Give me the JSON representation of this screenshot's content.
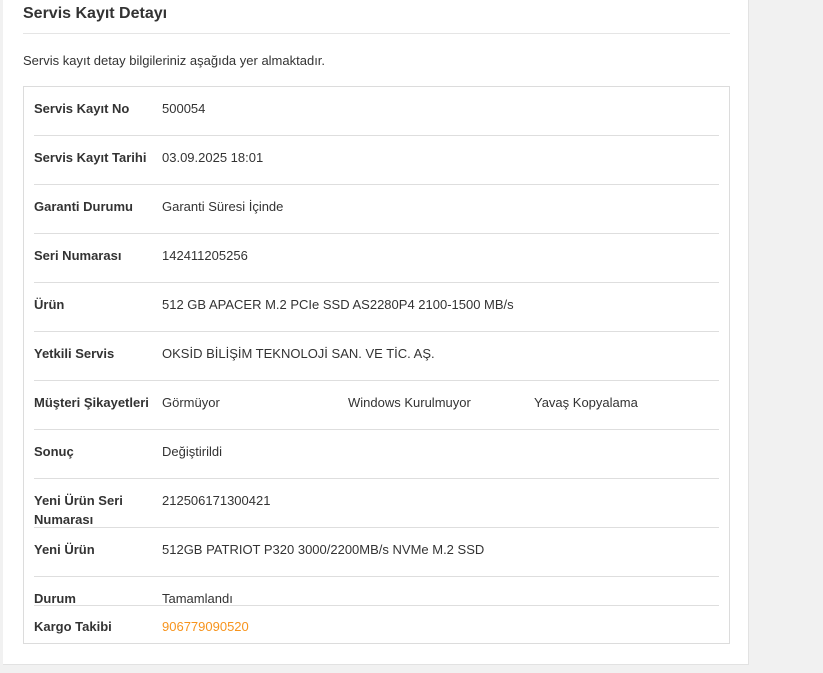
{
  "page": {
    "title": "Servis Kayıt Detayı",
    "intro": "Servis kayıt detay bilgileriniz aşağıda yer almaktadır."
  },
  "details": {
    "record_no": {
      "label": "Servis Kayıt No",
      "value": "500054"
    },
    "record_date": {
      "label": "Servis Kayıt Tarihi",
      "value": "03.09.2025 18:01"
    },
    "warranty": {
      "label": "Garanti Durumu",
      "value": "Garanti Süresi İçinde"
    },
    "serial": {
      "label": "Seri Numarası",
      "value": "142411205256"
    },
    "product": {
      "label": "Ürün",
      "value": "512 GB APACER M.2 PCIe SSD AS2280P4 2100-1500 MB/s"
    },
    "service": {
      "label": "Yetkili Servis",
      "value": "OKSİD BİLİŞİM TEKNOLOJİ SAN. VE TİC. AŞ."
    },
    "complaints": {
      "label": "Müşteri Şikayetleri",
      "values": [
        "Görmüyor",
        "Windows Kurulmuyor",
        "Yavaş Kopyalama"
      ]
    },
    "result": {
      "label": "Sonuç",
      "value": "Değiştirildi"
    },
    "new_serial": {
      "label": "Yeni Ürün Seri Numarası",
      "value": "212506171300421"
    },
    "new_product": {
      "label": "Yeni Ürün",
      "value": "512GB PATRIOT P320 3000/2200MB/s NVMe M.2 SSD"
    },
    "status": {
      "label": "Durum",
      "value": "Tamamlandı"
    },
    "tracking": {
      "label": "Kargo Takibi",
      "value": "906779090520"
    }
  },
  "colors": {
    "link": "#f7941d",
    "background": "#f1f1f1",
    "panel": "#ffffff"
  }
}
